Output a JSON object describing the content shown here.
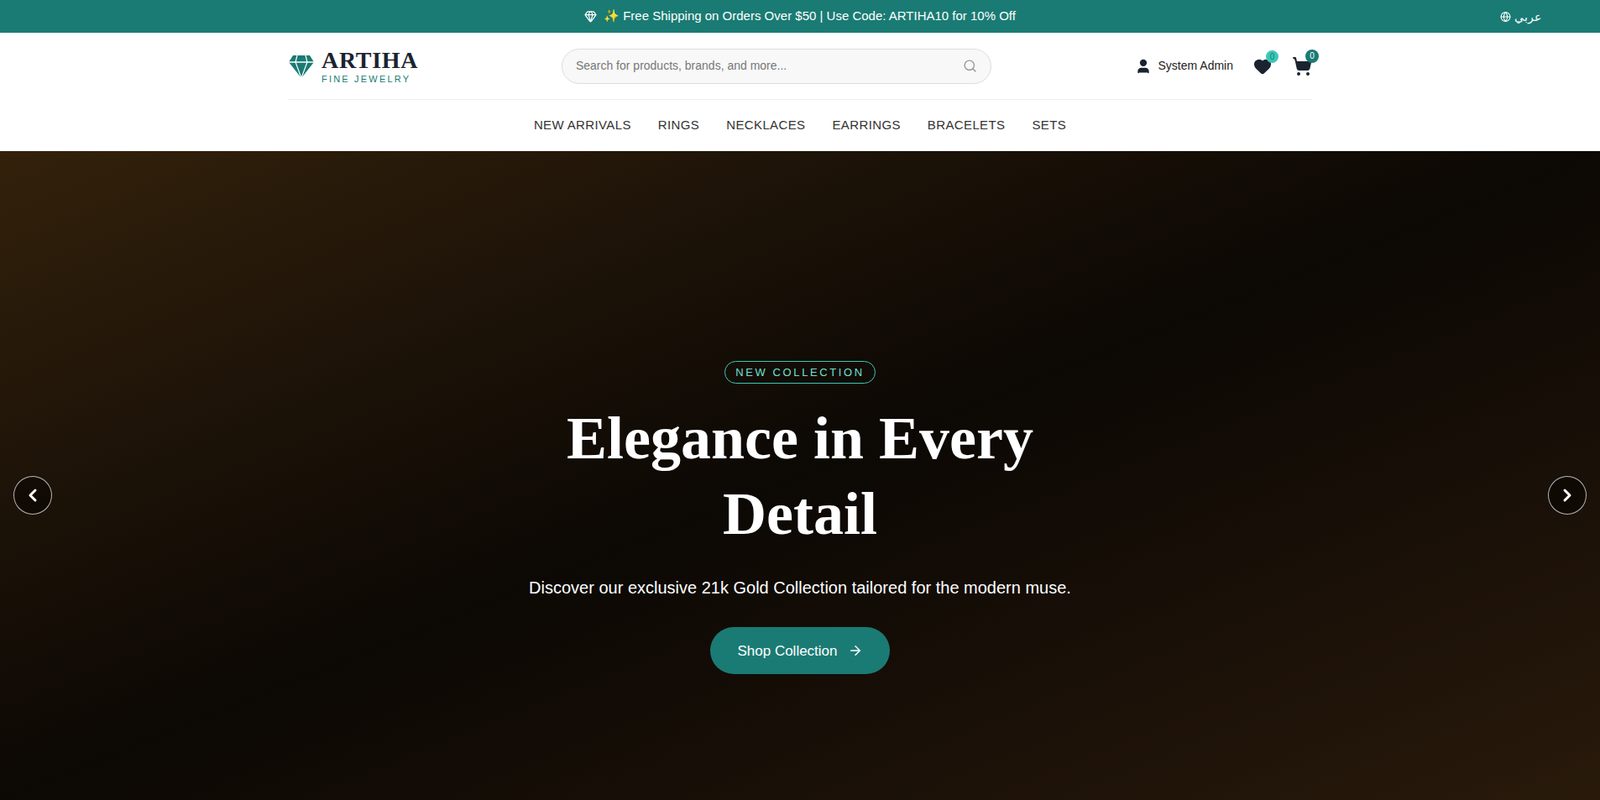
{
  "topbar": {
    "text": "✨ Free Shipping on Orders Over $50 | Use Code: ARTIHA10 for 10% Off",
    "language": "عربي"
  },
  "header": {
    "logo": {
      "name": "ARTIHA",
      "tagline": "FINE JEWELRY"
    },
    "search": {
      "placeholder": "Search for products, brands, and more..."
    },
    "user": "System Admin",
    "wishlist_count": "0",
    "cart_count": "0"
  },
  "nav": {
    "items": [
      "NEW ARRIVALS",
      "RINGS",
      "NECKLACES",
      "EARRINGS",
      "BRACELETS",
      "SETS"
    ]
  },
  "hero": {
    "badge": "NEW COLLECTION",
    "title": "Elegance in Every Detail",
    "subtitle": "Discover our exclusive 21k Gold Collection tailored for the modern muse.",
    "button": "Shop Collection"
  }
}
